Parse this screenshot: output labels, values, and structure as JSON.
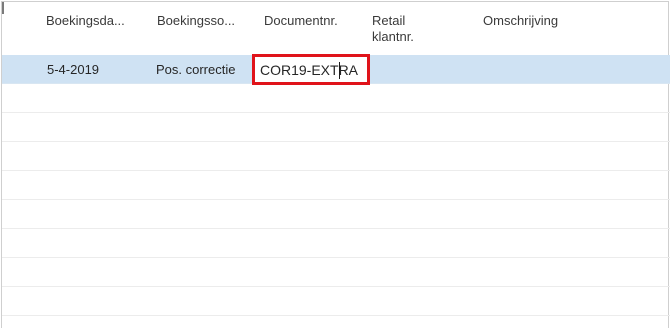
{
  "grid": {
    "columns": [
      {
        "label": "Boekingsda..."
      },
      {
        "label": "Boekingsso..."
      },
      {
        "label": "Documentnr."
      },
      {
        "label": "Retail klantnr."
      },
      {
        "label": "Omschrijving"
      }
    ],
    "rows": [
      {
        "boekingsdatum": "5-4-2019",
        "boekingssoort": "Pos. correctie",
        "documentnr": "COR19-EXTRA",
        "retail_klantnr": "",
        "omschrijving": ""
      }
    ]
  },
  "colors": {
    "selected_row": "#cfe2f3",
    "highlight_box": "#e0131a"
  }
}
